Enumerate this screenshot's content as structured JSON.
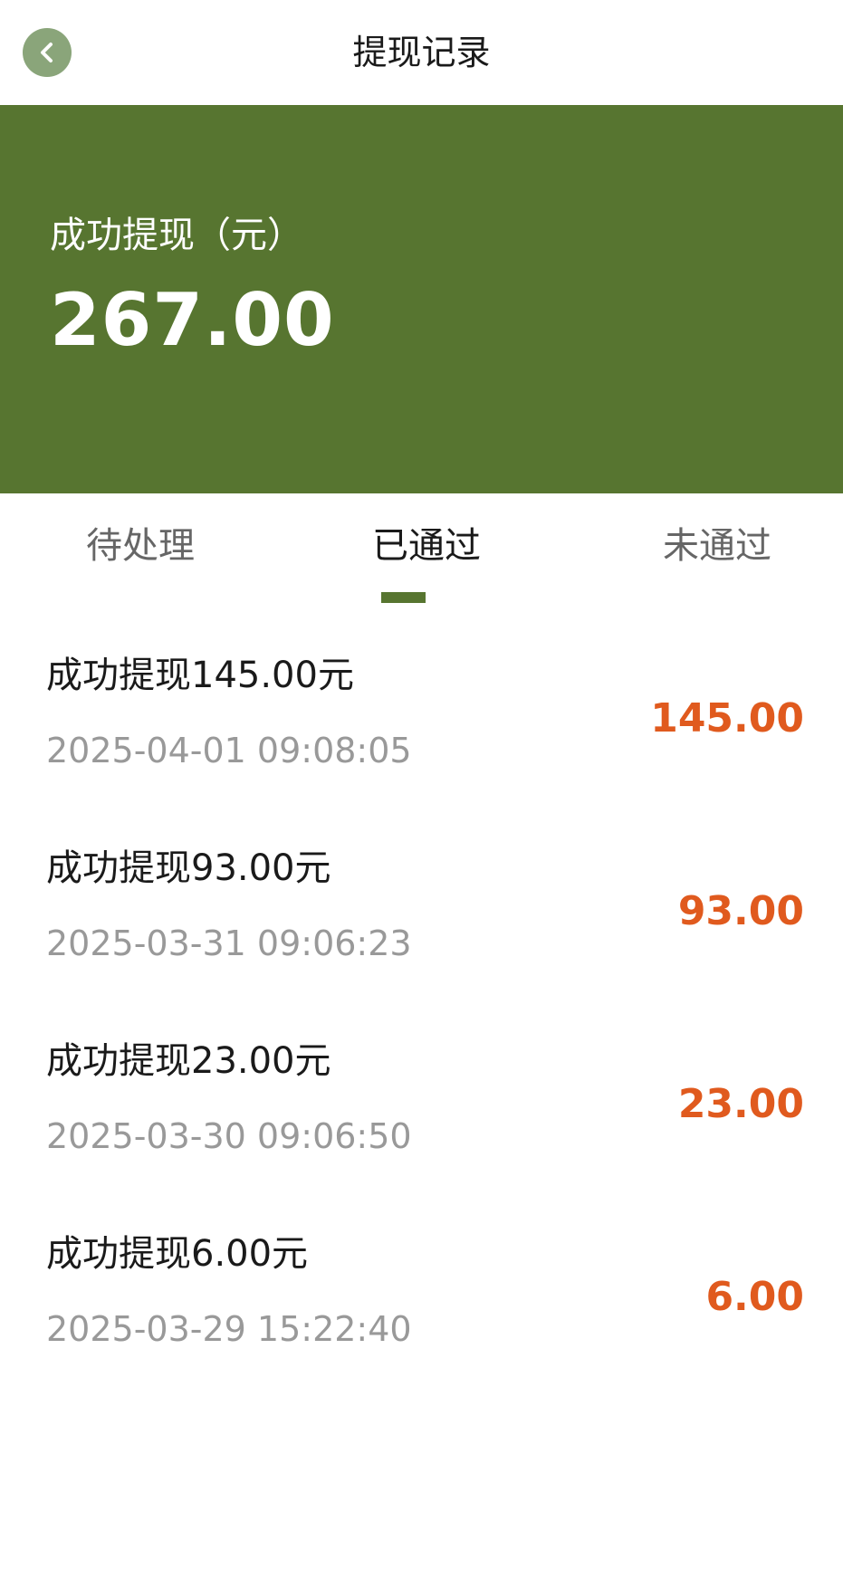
{
  "header": {
    "title": "提现记录",
    "back_icon": "chevron-left-icon",
    "back_color": "#8aa57a"
  },
  "summary": {
    "label": "成功提现（元）",
    "amount": "267.00",
    "background_color": "#577530"
  },
  "tabs": [
    {
      "label": "待处理",
      "active": false
    },
    {
      "label": "已通过",
      "active": true
    },
    {
      "label": "未通过",
      "active": false
    }
  ],
  "records": [
    {
      "title": "成功提现145.00元",
      "time": "2025-04-01 09:08:05",
      "amount": "145.00"
    },
    {
      "title": "成功提现93.00元",
      "time": "2025-03-31 09:06:23",
      "amount": "93.00"
    },
    {
      "title": "成功提现23.00元",
      "time": "2025-03-30 09:06:50",
      "amount": "23.00"
    },
    {
      "title": "成功提现6.00元",
      "time": "2025-03-29 15:22:40",
      "amount": "6.00"
    }
  ],
  "colors": {
    "accent": "#577530",
    "amount": "#e05a1e",
    "secondary_text": "#999999"
  }
}
